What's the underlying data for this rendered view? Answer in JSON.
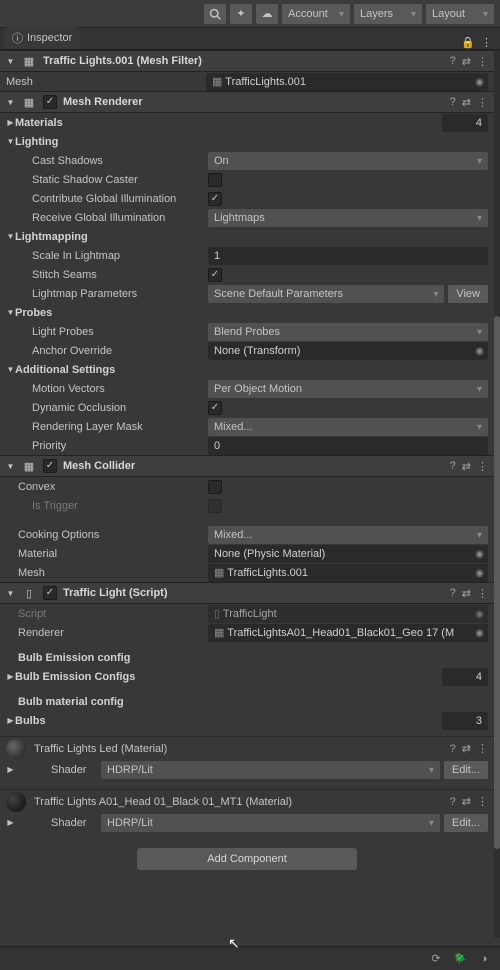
{
  "topbar": {
    "account": "Account",
    "layers": "Layers",
    "layout": "Layout"
  },
  "tab": {
    "name": "Inspector"
  },
  "meshFilter": {
    "title": "Traffic Lights.001 (Mesh Filter)",
    "meshLabel": "Mesh",
    "meshValue": "TrafficLights.001"
  },
  "meshRenderer": {
    "title": "Mesh Renderer",
    "materialsLabel": "Materials",
    "materialsCount": "4",
    "lighting": {
      "header": "Lighting",
      "castShadowsLabel": "Cast Shadows",
      "castShadowsValue": "On",
      "staticShadowCasterLabel": "Static Shadow Caster",
      "contributeGILabel": "Contribute Global Illumination",
      "receiveGILabel": "Receive Global Illumination",
      "receiveGIValue": "Lightmaps"
    },
    "lightmapping": {
      "header": "Lightmapping",
      "scaleLabel": "Scale In Lightmap",
      "scaleValue": "1",
      "stitchLabel": "Stitch Seams",
      "paramsLabel": "Lightmap Parameters",
      "paramsValue": "Scene Default Parameters",
      "viewBtn": "View"
    },
    "probes": {
      "header": "Probes",
      "lightProbesLabel": "Light Probes",
      "lightProbesValue": "Blend Probes",
      "anchorLabel": "Anchor Override",
      "anchorValue": "None (Transform)"
    },
    "additional": {
      "header": "Additional Settings",
      "motionLabel": "Motion Vectors",
      "motionValue": "Per Object Motion",
      "dynOccLabel": "Dynamic Occlusion",
      "renderLayerLabel": "Rendering Layer Mask",
      "renderLayerValue": "Mixed...",
      "priorityLabel": "Priority",
      "priorityValue": "0"
    }
  },
  "meshCollider": {
    "title": "Mesh Collider",
    "convexLabel": "Convex",
    "isTriggerLabel": "Is Trigger",
    "cookingLabel": "Cooking Options",
    "cookingValue": "Mixed...",
    "materialLabel": "Material",
    "materialValue": "None (Physic Material)",
    "meshLabel": "Mesh",
    "meshValue": "TrafficLights.001"
  },
  "trafficLight": {
    "title": "Traffic Light (Script)",
    "scriptLabel": "Script",
    "scriptValue": "TrafficLight",
    "rendererLabel": "Renderer",
    "rendererValue": "TrafficLightsA01_Head01_Black01_Geo 17 (M",
    "bulbEmHeader": "Bulb Emission config",
    "bulbEmConfigsLabel": "Bulb Emission Configs",
    "bulbEmConfigsCount": "4",
    "bulbMatHeader": "Bulb material config",
    "bulbsLabel": "Bulbs",
    "bulbsCount": "3"
  },
  "materials": {
    "led": {
      "title": "Traffic Lights Led (Material)",
      "shaderLabel": "Shader",
      "shaderValue": "HDRP/Lit",
      "editBtn": "Edit..."
    },
    "head": {
      "title": "Traffic Lights A01_Head 01_Black 01_MT1 (Material)",
      "shaderLabel": "Shader",
      "shaderValue": "HDRP/Lit",
      "editBtn": "Edit..."
    }
  },
  "addComponent": "Add Component"
}
